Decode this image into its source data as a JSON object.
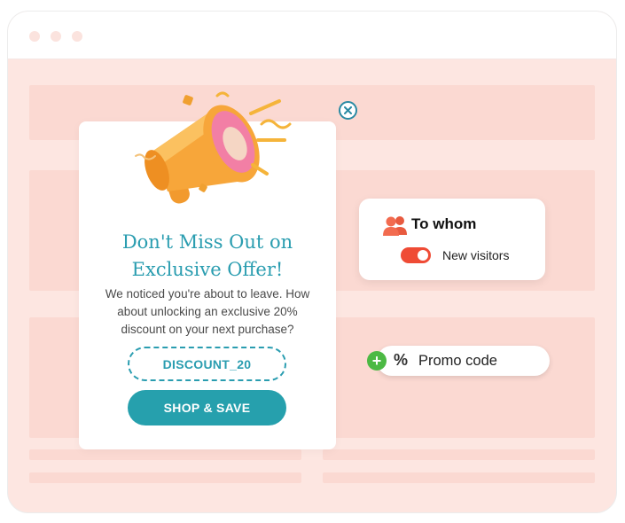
{
  "popup": {
    "headline_line1": "Don't Miss Out on",
    "headline_line2": "Exclusive Offer!",
    "body_line1": "We noticed you're about to leave. How",
    "body_line2": "about unlocking an exclusive 20%",
    "body_line3": "discount on your next purchase?",
    "coupon_code": "DISCOUNT_20",
    "cta_label": "SHOP & SAVE",
    "close_icon": "close-icon",
    "image": "megaphone-icon"
  },
  "targeting": {
    "title": "To whom",
    "icon": "users-icon",
    "toggle_label": "New visitors",
    "toggle_on": true
  },
  "promo": {
    "label": "Promo code",
    "badge": "+",
    "symbol": "%"
  },
  "colors": {
    "teal": "#2a9db0",
    "button_teal": "#26a0ad",
    "toggle_red": "#ef4b35",
    "badge_green": "#4cb944",
    "page_pink": "#fde6e1",
    "placeholder_pink": "#fbd9d2",
    "megaphone_orange": "#f7a63a"
  }
}
